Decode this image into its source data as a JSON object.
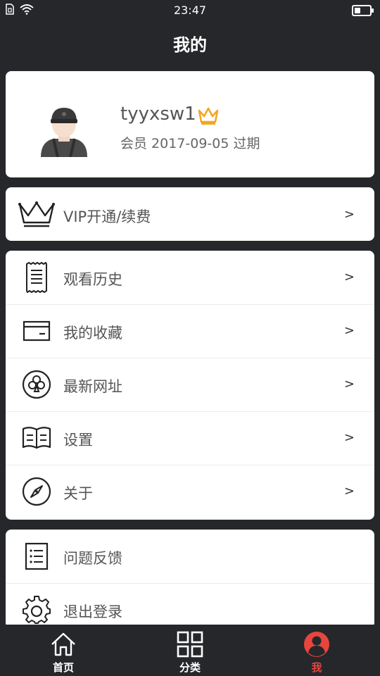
{
  "status_bar": {
    "time": "23:47"
  },
  "header": {
    "title": "我的"
  },
  "profile": {
    "username": "tyyxsw1",
    "member_info": "会员 2017-09-05 过期"
  },
  "vip": {
    "label": "VIP开通/续费",
    "chevron": ">"
  },
  "menu": [
    {
      "label": "观看历史",
      "chevron": ">",
      "icon": "receipt-icon"
    },
    {
      "label": "我的收藏",
      "chevron": ">",
      "icon": "wallet-icon"
    },
    {
      "label": "最新网址",
      "chevron": ">",
      "icon": "club-icon"
    },
    {
      "label": "设置",
      "chevron": ">",
      "icon": "book-icon"
    },
    {
      "label": "关于",
      "chevron": ">",
      "icon": "compass-icon"
    }
  ],
  "menu2": [
    {
      "label": "问题反馈",
      "icon": "list-doc-icon"
    },
    {
      "label": "退出登录",
      "icon": "gear-icon"
    }
  ],
  "nav": [
    {
      "label": "首页",
      "icon": "home-icon"
    },
    {
      "label": "分类",
      "icon": "grid-icon"
    },
    {
      "label": "我",
      "icon": "user-icon",
      "active": true
    }
  ],
  "colors": {
    "background": "#26272b",
    "active": "#e8453c",
    "crown_badge": "#f5a623"
  }
}
